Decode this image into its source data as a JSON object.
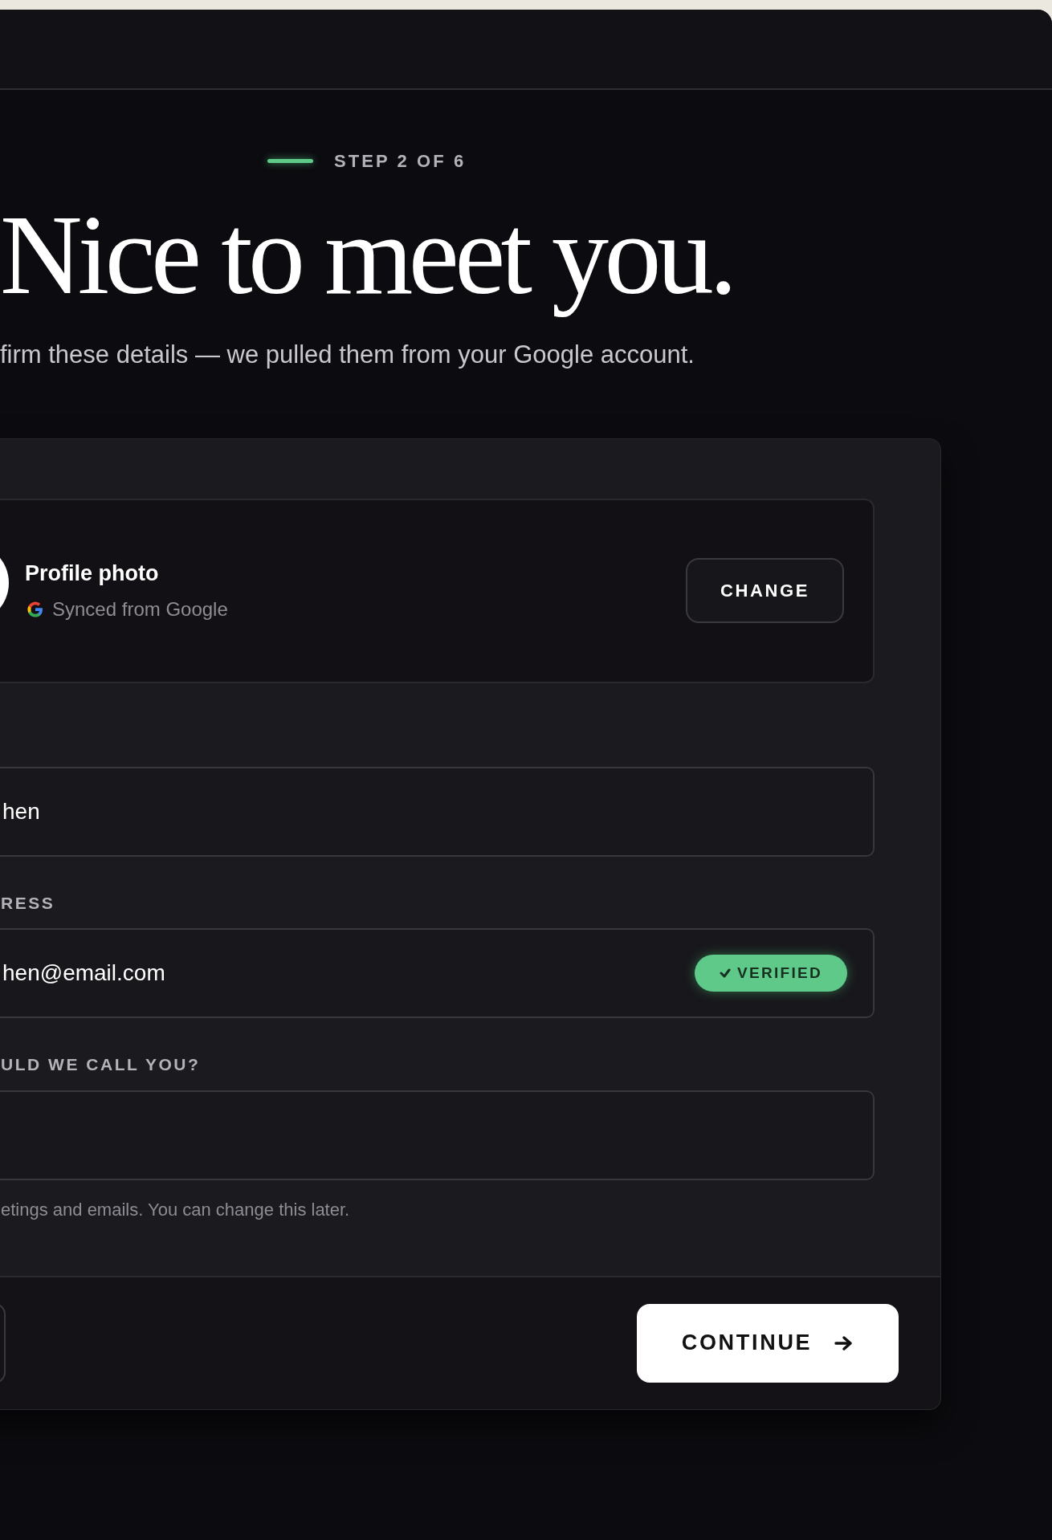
{
  "step": {
    "label": "STEP 2 OF 6"
  },
  "heading": "Nice to meet you.",
  "subtitle": "firm these details — we pulled them from your Google account.",
  "profile_photo": {
    "title": "Profile photo",
    "source": "Synced from Google",
    "button": "CHANGE"
  },
  "fields": [
    {
      "value": "hen"
    },
    {
      "label": "RESS",
      "value": "hen@email.com",
      "badge": "VERIFIED"
    },
    {
      "label": "ULD WE CALL YOU?"
    }
  ],
  "helper": "etings and emails. You can change this later.",
  "footer": {
    "continue_button": "CONTINUE"
  }
}
